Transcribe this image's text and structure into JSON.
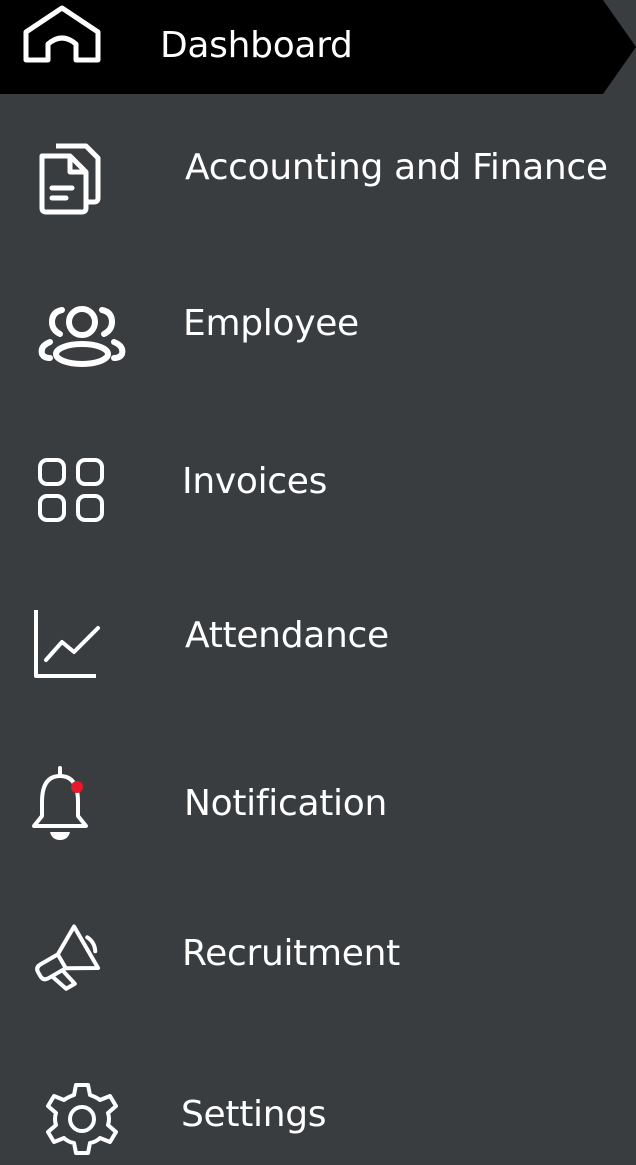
{
  "sidebar": {
    "active_item": {
      "label": "Dashboard",
      "icon": "home-icon"
    },
    "items": [
      {
        "label": "Accounting and Finance",
        "icon": "documents-icon"
      },
      {
        "label": "Employee",
        "icon": "users-icon"
      },
      {
        "label": "Invoices",
        "icon": "grid-icon"
      },
      {
        "label": "Attendance",
        "icon": "chart-icon"
      },
      {
        "label": "Notification",
        "icon": "bell-icon",
        "has_unread_dot": true
      },
      {
        "label": "Recruitment",
        "icon": "megaphone-icon"
      },
      {
        "label": "Settings",
        "icon": "gear-icon"
      }
    ]
  },
  "colors": {
    "background": "#3a3d40",
    "active_background": "#000000",
    "text": "#ffffff",
    "icon": "#ffffff",
    "notification_dot": "#e8172b"
  }
}
